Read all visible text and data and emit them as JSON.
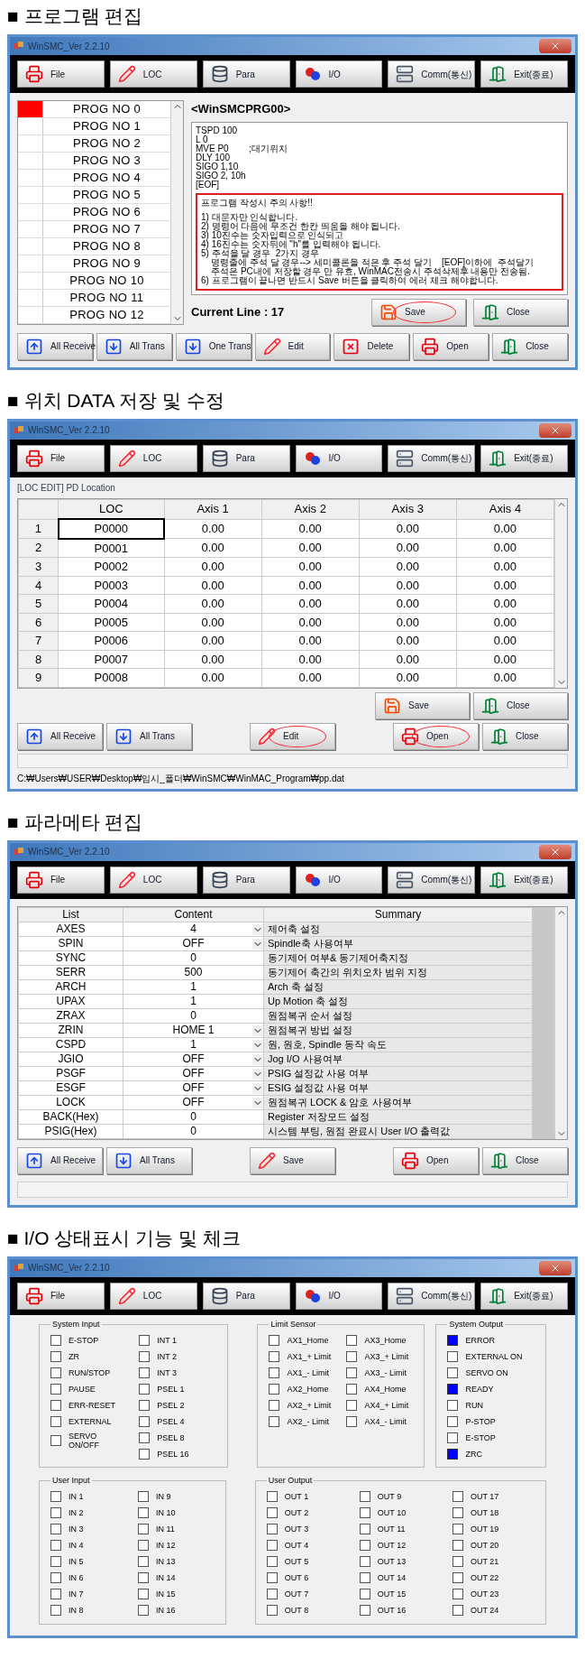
{
  "sections": [
    {
      "heading": "■ 프로그램 편집",
      "window": {
        "title": "WinSMC_Ver 2.2.10",
        "kind": "program",
        "toolbar": [
          {
            "label": "File",
            "kind": "file"
          },
          {
            "label": "LOC",
            "kind": "loc"
          },
          {
            "label": "Para",
            "kind": "para"
          },
          {
            "label": "I/O",
            "kind": "io"
          },
          {
            "label": "Comm(통신)",
            "kind": "comm"
          },
          {
            "label": "Exit(종료)",
            "kind": "exit"
          }
        ],
        "programs": [
          {
            "label": "PROG NO 0",
            "selected": true
          },
          {
            "label": "PROG NO 1",
            "selected": false
          },
          {
            "label": "PROG NO 2",
            "selected": false
          },
          {
            "label": "PROG NO 3",
            "selected": false
          },
          {
            "label": "PROG NO 4",
            "selected": false
          },
          {
            "label": "PROG NO 5",
            "selected": false
          },
          {
            "label": "PROG NO 6",
            "selected": false
          },
          {
            "label": "PROG NO 7",
            "selected": false
          },
          {
            "label": "PROG NO 8",
            "selected": false
          },
          {
            "label": "PROG NO 9",
            "selected": false
          },
          {
            "label": "PROG NO 10",
            "selected": false
          },
          {
            "label": "PROG NO 11",
            "selected": false
          },
          {
            "label": "PROG NO 12",
            "selected": false
          }
        ],
        "file_title": "<WinSMCPRG00>",
        "code": [
          "TSPD 100",
          "L 0",
          "MVE P0        ;대기위치",
          "DLY 100",
          "SIGO 1,10",
          "SIGO 2, 10h",
          "[EOF]"
        ],
        "notes": {
          "highlighted": true,
          "heading": "프로그램 작성시 주의 사항!!",
          "lines": [
            "1) 대문자만 인식합니다.",
            "2) 명령어 다음에 무조건 한칸 띄움을 해야 됩니다.",
            "3) 10진수는 숫자입력으로 인식되고",
            "4) 16진수는 숫자뒤에 \"h\"를 입력해야 됩니다.",
            "5) 주석을 달 경우  2가지 경우",
            "    명령줄에 주석 달 경우--> 세미콜론을 적은 후 주석 달기    [EOF]이하에  주석달기",
            "    주석은 PC내에 저장할 경우 만 유효, WinMAC전송시 주석삭제후 내용만 전송됨.",
            "6) 프로그램이 끝나면 반드시 Save 버튼을 클릭하여 에러 체크 해야합니다."
          ]
        },
        "current_line": "Current Line : 17",
        "editor_buttons": [
          {
            "label": "Save",
            "kind": "save",
            "circled": true
          },
          {
            "label": "Close",
            "kind": "exit",
            "circled": false
          }
        ],
        "buttons": [
          {
            "label": "All Receive",
            "kind": "receive",
            "circled": false
          },
          {
            "label": "All Trans",
            "kind": "trans",
            "circled": false
          },
          {
            "label": "One Trans",
            "kind": "trans",
            "circled": false
          },
          {
            "label": "Edit",
            "kind": "loc",
            "circled": false
          },
          {
            "label": "Delete",
            "kind": "delete",
            "circled": false
          },
          {
            "label": "Open",
            "kind": "file",
            "circled": false
          },
          {
            "label": "Close",
            "kind": "exit",
            "circled": false
          }
        ]
      }
    },
    {
      "heading": "■ 위치 DATA 저장 및 수정",
      "window": {
        "title": "WinSMC_Ver 2.2.10",
        "kind": "location",
        "toolbar": [
          {
            "label": "File",
            "kind": "file"
          },
          {
            "label": "LOC",
            "kind": "loc"
          },
          {
            "label": "Para",
            "kind": "para"
          },
          {
            "label": "I/O",
            "kind": "io"
          },
          {
            "label": "Comm(통신)",
            "kind": "comm"
          },
          {
            "label": "Exit(종료)",
            "kind": "exit"
          }
        ],
        "caption": "[LOC EDIT] PD Location",
        "columns": [
          "LOC",
          "Axis 1",
          "Axis 2",
          "Axis 3",
          "Axis 4"
        ],
        "rows": [
          {
            "number": "1",
            "loc": "P0000",
            "values": [
              "0.00",
              "0.00",
              "0.00",
              "0.00"
            ],
            "selected": true
          },
          {
            "number": "2",
            "loc": "P0001",
            "values": [
              "0.00",
              "0.00",
              "0.00",
              "0.00"
            ],
            "selected": false
          },
          {
            "number": "3",
            "loc": "P0002",
            "values": [
              "0.00",
              "0.00",
              "0.00",
              "0.00"
            ],
            "selected": false
          },
          {
            "number": "4",
            "loc": "P0003",
            "values": [
              "0.00",
              "0.00",
              "0.00",
              "0.00"
            ],
            "selected": false
          },
          {
            "number": "5",
            "loc": "P0004",
            "values": [
              "0.00",
              "0.00",
              "0.00",
              "0.00"
            ],
            "selected": false
          },
          {
            "number": "6",
            "loc": "P0005",
            "values": [
              "0.00",
              "0.00",
              "0.00",
              "0.00"
            ],
            "selected": false
          },
          {
            "number": "7",
            "loc": "P0006",
            "values": [
              "0.00",
              "0.00",
              "0.00",
              "0.00"
            ],
            "selected": false
          },
          {
            "number": "8",
            "loc": "P0007",
            "values": [
              "0.00",
              "0.00",
              "0.00",
              "0.00"
            ],
            "selected": false
          },
          {
            "number": "9",
            "loc": "P0008",
            "values": [
              "0.00",
              "0.00",
              "0.00",
              "0.00"
            ],
            "selected": false
          }
        ],
        "editor_buttons": [
          {
            "label": "Save",
            "kind": "save",
            "circled": false
          },
          {
            "label": "Close",
            "kind": "exit",
            "circled": false
          }
        ],
        "button_groups": [
          [
            {
              "label": "All Receive",
              "kind": "receive",
              "circled": false
            },
            {
              "label": "All Trans",
              "kind": "trans",
              "circled": false
            }
          ],
          [
            {
              "label": "Edit",
              "kind": "loc",
              "circled": true
            }
          ],
          [
            {
              "label": "Open",
              "kind": "file",
              "circled": true
            },
            {
              "label": "Close",
              "kind": "exit",
              "circled": false
            }
          ]
        ],
        "path": "C:₩Users₩USER₩Desktop₩임시_폴더₩WinSMC₩WinMAC_Program₩pp.dat"
      }
    },
    {
      "heading": "■ 파라메타 편집",
      "window": {
        "title": "WinSMC_Ver 2.2.10",
        "kind": "parameter",
        "toolbar": [
          {
            "label": "File",
            "kind": "file"
          },
          {
            "label": "LOC",
            "kind": "loc"
          },
          {
            "label": "Para",
            "kind": "para"
          },
          {
            "label": "I/O",
            "kind": "io"
          },
          {
            "label": "Comm(통신)",
            "kind": "comm"
          },
          {
            "label": "Exit(종료)",
            "kind": "exit"
          }
        ],
        "columns": [
          "List",
          "Content",
          "Summary"
        ],
        "rows": [
          {
            "name": "AXES",
            "content": "4",
            "dropdown": true,
            "summary": "제어축 설정"
          },
          {
            "name": "SPIN",
            "content": "OFF",
            "dropdown": true,
            "summary": "Spindle축 사용여부"
          },
          {
            "name": "SYNC",
            "content": "0",
            "dropdown": false,
            "summary": "동기제어 여부& 동기제어축지정"
          },
          {
            "name": "SERR",
            "content": "500",
            "dropdown": false,
            "summary": "동기제어 축간의 위치오차 범위 지정"
          },
          {
            "name": "ARCH",
            "content": "1",
            "dropdown": false,
            "summary": "Arch 축 설정"
          },
          {
            "name": "UPAX",
            "content": "1",
            "dropdown": false,
            "summary": "Up Motion 축 설정"
          },
          {
            "name": "ZRAX",
            "content": "0",
            "dropdown": false,
            "summary": "원점복귀 순서 설정"
          },
          {
            "name": "ZRIN",
            "content": "HOME 1",
            "dropdown": true,
            "summary": "원점복귀 방법 설정"
          },
          {
            "name": "CSPD",
            "content": "1",
            "dropdown": true,
            "summary": "원, 원호, Spindle 동작 속도"
          },
          {
            "name": "JGIO",
            "content": "OFF",
            "dropdown": true,
            "summary": "Jog I/O 사용여부"
          },
          {
            "name": "PSGF",
            "content": "OFF",
            "dropdown": true,
            "summary": "PSIG 설정값 사용 여부"
          },
          {
            "name": "ESGF",
            "content": "OFF",
            "dropdown": true,
            "summary": "ESIG 설정값 사용 여부"
          },
          {
            "name": "LOCK",
            "content": "OFF",
            "dropdown": true,
            "summary": "원점복귀 LOCK & 암호 사용여부"
          },
          {
            "name": "BACK(Hex)",
            "content": "0",
            "dropdown": false,
            "summary": "Register 저장모드 설정"
          },
          {
            "name": "PSIG(Hex)",
            "content": "0",
            "dropdown": false,
            "summary": "시스템 부팅, 원점 완료시 User I/O 출력값"
          }
        ],
        "button_groups": [
          [
            {
              "label": "All Receive",
              "kind": "receive",
              "circled": false
            },
            {
              "label": "All Trans",
              "kind": "trans",
              "circled": false
            }
          ],
          [
            {
              "label": "Save",
              "kind": "loc",
              "circled": false
            }
          ],
          [
            {
              "label": "Open",
              "kind": "file",
              "circled": false
            },
            {
              "label": "Close",
              "kind": "exit",
              "circled": false
            }
          ]
        ]
      }
    },
    {
      "heading": "■ I/O 상태표시 기능 및 체크",
      "window": {
        "title": "WinSMC_Ver 2.2.10",
        "kind": "io",
        "toolbar": [
          {
            "label": "File",
            "kind": "file"
          },
          {
            "label": "LOC",
            "kind": "loc"
          },
          {
            "label": "Para",
            "kind": "para"
          },
          {
            "label": "I/O",
            "kind": "io"
          },
          {
            "label": "Comm(통신)",
            "kind": "comm"
          },
          {
            "label": "Exit(종료)",
            "kind": "exit"
          }
        ],
        "groups": [
          {
            "title": "System Input",
            "columns": [
              [
                {
                  "label": "E-STOP",
                  "checked": false
                },
                {
                  "label": "ZR",
                  "checked": false
                },
                {
                  "label": "RUN/STOP",
                  "checked": false
                },
                {
                  "label": "PAUSE",
                  "checked": false
                },
                {
                  "label": "ERR-RESET",
                  "checked": false
                },
                {
                  "label": "EXTERNAL",
                  "checked": false
                },
                {
                  "label": "SERVO ON/OFF",
                  "checked": false
                }
              ],
              [
                {
                  "label": "INT 1",
                  "checked": false
                },
                {
                  "label": "INT 2",
                  "checked": false
                },
                {
                  "label": "INT 3",
                  "checked": false
                },
                {
                  "label": "PSEL 1",
                  "checked": false
                },
                {
                  "label": "PSEL 2",
                  "checked": false
                },
                {
                  "label": "PSEL 4",
                  "checked": false
                },
                {
                  "label": "PSEL 8",
                  "checked": false
                },
                {
                  "label": "PSEL 16",
                  "checked": false
                }
              ]
            ]
          },
          {
            "title": "Limit Sensor",
            "columns": [
              [
                {
                  "label": "AX1_Home",
                  "checked": false
                },
                {
                  "label": "AX1_+ Limit",
                  "checked": false
                },
                {
                  "label": "AX1_- Limit",
                  "checked": false
                },
                {
                  "label": "AX2_Home",
                  "checked": false
                },
                {
                  "label": "AX2_+ Limit",
                  "checked": false
                },
                {
                  "label": "AX2_- Limit",
                  "checked": false
                }
              ],
              [
                {
                  "label": "AX3_Home",
                  "checked": false
                },
                {
                  "label": "AX3_+ Limit",
                  "checked": false
                },
                {
                  "label": "AX3_- Limit",
                  "checked": false
                },
                {
                  "label": "AX4_Home",
                  "checked": false
                },
                {
                  "label": "AX4_+ Limit",
                  "checked": false
                },
                {
                  "label": "AX4_- Limit",
                  "checked": false
                }
              ]
            ]
          },
          {
            "title": "System Output",
            "columns": [
              [
                {
                  "label": "ERROR",
                  "checked": true
                },
                {
                  "label": "EXTERNAL ON",
                  "checked": false
                },
                {
                  "label": "SERVO ON",
                  "checked": false
                },
                {
                  "label": "READY",
                  "checked": true
                },
                {
                  "label": "RUN",
                  "checked": false
                },
                {
                  "label": "P-STOP",
                  "checked": false
                },
                {
                  "label": "E-STOP",
                  "checked": false
                },
                {
                  "label": "ZRC",
                  "checked": true
                }
              ]
            ]
          },
          {
            "title": "User Input",
            "columns": [
              [
                {
                  "label": "IN 1",
                  "checked": false
                },
                {
                  "label": "IN 2",
                  "checked": false
                },
                {
                  "label": "IN 3",
                  "checked": false
                },
                {
                  "label": "IN 4",
                  "checked": false
                },
                {
                  "label": "IN 5",
                  "checked": false
                },
                {
                  "label": "IN 6",
                  "checked": false
                },
                {
                  "label": "IN 7",
                  "checked": false
                },
                {
                  "label": "IN 8",
                  "checked": false
                }
              ],
              [
                {
                  "label": "IN 9",
                  "checked": false
                },
                {
                  "label": "IN 10",
                  "checked": false
                },
                {
                  "label": "IN 11",
                  "checked": false
                },
                {
                  "label": "IN 12",
                  "checked": false
                },
                {
                  "label": "IN 13",
                  "checked": false
                },
                {
                  "label": "IN 14",
                  "checked": false
                },
                {
                  "label": "IN 15",
                  "checked": false
                },
                {
                  "label": "IN 16",
                  "checked": false
                }
              ]
            ]
          },
          {
            "title": "User Output",
            "columns": [
              [
                {
                  "label": "OUT 1",
                  "checked": false
                },
                {
                  "label": "OUT 2",
                  "checked": false
                },
                {
                  "label": "OUT 3",
                  "checked": false
                },
                {
                  "label": "OUT 4",
                  "checked": false
                },
                {
                  "label": "OUT 5",
                  "checked": false
                },
                {
                  "label": "OUT 6",
                  "checked": false
                },
                {
                  "label": "OUT 7",
                  "checked": false
                },
                {
                  "label": "OUT 8",
                  "checked": false
                }
              ],
              [
                {
                  "label": "OUT 9",
                  "checked": false
                },
                {
                  "label": "OUT 10",
                  "checked": false
                },
                {
                  "label": "OUT 11",
                  "checked": false
                },
                {
                  "label": "OUT 12",
                  "checked": false
                },
                {
                  "label": "OUT 13",
                  "checked": false
                },
                {
                  "label": "OUT 14",
                  "checked": false
                },
                {
                  "label": "OUT 15",
                  "checked": false
                },
                {
                  "label": "OUT 16",
                  "checked": false
                }
              ],
              [
                {
                  "label": "OUT 17",
                  "checked": false
                },
                {
                  "label": "OUT 18",
                  "checked": false
                },
                {
                  "label": "OUT 19",
                  "checked": false
                },
                {
                  "label": "OUT 20",
                  "checked": false
                },
                {
                  "label": "OUT 21",
                  "checked": false
                },
                {
                  "label": "OUT 22",
                  "checked": false
                },
                {
                  "label": "OUT 23",
                  "checked": false
                },
                {
                  "label": "OUT 24",
                  "checked": false
                }
              ]
            ]
          }
        ]
      }
    }
  ]
}
